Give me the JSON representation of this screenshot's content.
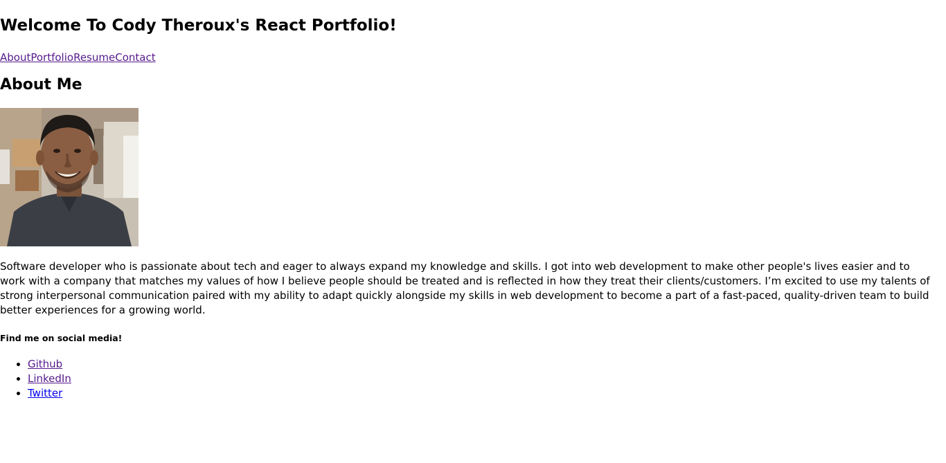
{
  "header": {
    "title": "Welcome To Cody Theroux's React Portfolio!"
  },
  "nav": {
    "items": [
      "About",
      "Portfolio",
      "Resume",
      "Contact"
    ]
  },
  "about": {
    "heading": "About Me",
    "bio": "Software developer who is passionate about tech and eager to always expand my knowledge and skills. I got into web development to make other people's lives easier and to work with a company that matches my values of how I believe people should be treated and is reflected in how they treat their clients/customers. I’m excited to use my talents of strong interpersonal communication paired with my ability to adapt quickly alongside my skills in web development to become a part of a fast-paced, quality-driven team to build better experiences for a growing world.",
    "social_heading": "Find me on social media!",
    "social_links": [
      "Github",
      "LinkedIn",
      "Twitter"
    ]
  },
  "colors": {
    "visited_link": "#551a8b",
    "unvisited_link": "#0000ee"
  }
}
